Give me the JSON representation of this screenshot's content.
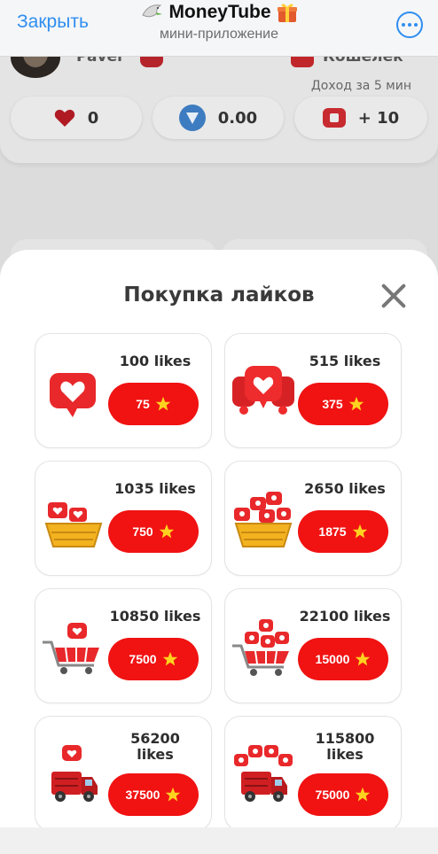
{
  "telegram": {
    "close_label": "Закрыть",
    "app_name": "MoneyTube",
    "subtitle": "мини-приложение"
  },
  "background": {
    "user_name": "Pavel",
    "wallet_label": "Кошелек",
    "income_label": "Доход за 5 мин",
    "stats": {
      "likes": "0",
      "ton": "0.00",
      "income": "+ 10"
    }
  },
  "sheet": {
    "title": "Покупка лайков",
    "packages": [
      {
        "label": "100 likes",
        "price": "75",
        "icon": "single-heart-bubble"
      },
      {
        "label": "515 likes",
        "price": "375",
        "icon": "heart-bubbles-cluster"
      },
      {
        "label": "1035 likes",
        "price": "750",
        "icon": "basket-small"
      },
      {
        "label": "2650 likes",
        "price": "1875",
        "icon": "basket-large"
      },
      {
        "label": "10850 likes",
        "price": "7500",
        "icon": "cart-small"
      },
      {
        "label": "22100 likes",
        "price": "15000",
        "icon": "cart-large"
      },
      {
        "label": "56200 likes",
        "price": "37500",
        "icon": "truck-small"
      },
      {
        "label": "115800 likes",
        "price": "75000",
        "icon": "truck-large"
      }
    ]
  },
  "colors": {
    "accent_red": "#f11212",
    "telegram_blue": "#2f8ef0",
    "star_yellow": "#ffd21f"
  }
}
